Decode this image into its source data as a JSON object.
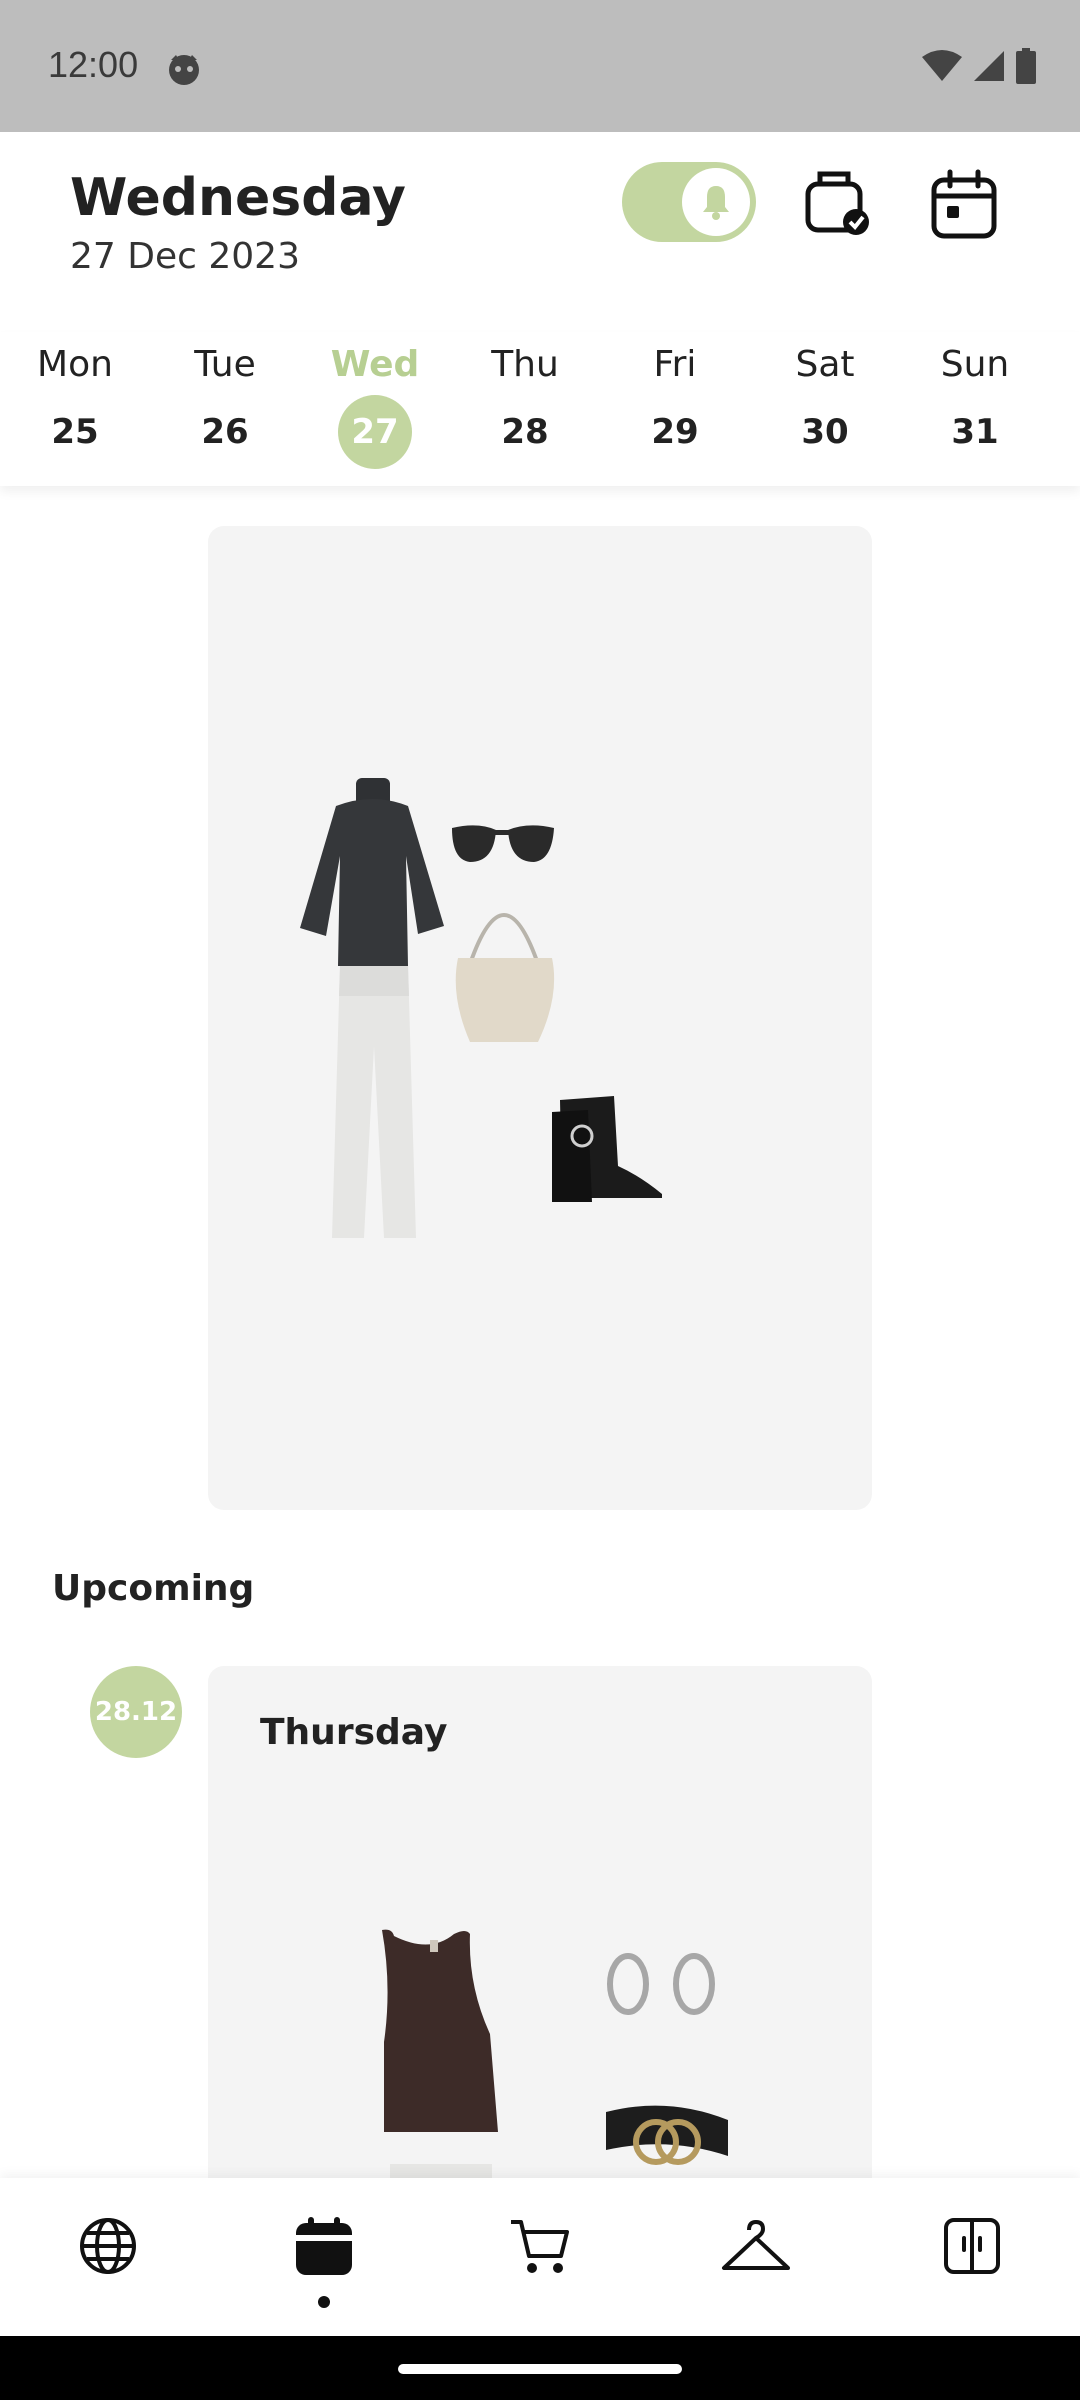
{
  "status_bar": {
    "time": "12:00"
  },
  "header": {
    "day_title": "Wednesday",
    "date": "27 Dec 2023",
    "notifications_toggle_on": true,
    "accent_color": "#c3d6a0"
  },
  "week": [
    {
      "name": "Mon",
      "num": "25",
      "active": false
    },
    {
      "name": "Tue",
      "num": "26",
      "active": false
    },
    {
      "name": "Wed",
      "num": "27",
      "active": true
    },
    {
      "name": "Thu",
      "num": "28",
      "active": false
    },
    {
      "name": "Fri",
      "num": "29",
      "active": false
    },
    {
      "name": "Sat",
      "num": "30",
      "active": false
    },
    {
      "name": "Sun",
      "num": "31",
      "active": false
    }
  ],
  "today_outfit": {
    "items": [
      "turtleneck-sweater",
      "white-trousers",
      "sunglasses",
      "shoulder-bag",
      "ankle-boots"
    ]
  },
  "upcoming": {
    "heading": "Upcoming",
    "entries": [
      {
        "badge": "28.12",
        "title": "Thursday",
        "items": [
          "tank-top",
          "hoop-earrings",
          "belt",
          "white-trousers"
        ]
      }
    ]
  },
  "bottom_nav": {
    "items": [
      "globe-icon",
      "calendar-wallet-icon",
      "cart-icon",
      "hanger-icon",
      "wardrobe-icon"
    ],
    "active_index": 1
  }
}
